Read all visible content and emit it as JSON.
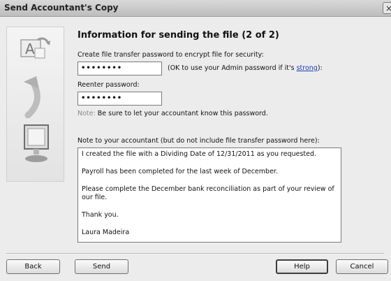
{
  "window": {
    "title": "Send Accountant's Copy",
    "close_label": "×"
  },
  "left_panel": {
    "icons": [
      "letter-a-swap-icon",
      "curved-arrow-icon",
      "monitor-icon"
    ]
  },
  "main": {
    "heading": "Information for sending the file (2 of 2)",
    "create_password_label": "Create file transfer password to encrypt file for security:",
    "password_value": "••••••••",
    "hint_text": "(OK to use your Admin password if it's ",
    "hint_link": "strong",
    "hint_close": "):",
    "reenter_label": "Reenter password:",
    "reenter_value": "••••••••",
    "note_label": "Note:",
    "note_text": "Be sure to let your accountant know this password.",
    "note_to_accountant_label": "Note to your accountant (but do not include file transfer password here):",
    "message_lines": [
      "I created the file with a Dividing Date of 12/31/2011 as you requested.",
      "Payroll has been completed for the last week of December.",
      "Please complete the December bank reconciliation as part of your review of our file.",
      "Thank you.",
      "Laura Madeira"
    ]
  },
  "buttons": {
    "back": "Back",
    "send": "Send",
    "help": "Help",
    "cancel": "Cancel"
  }
}
